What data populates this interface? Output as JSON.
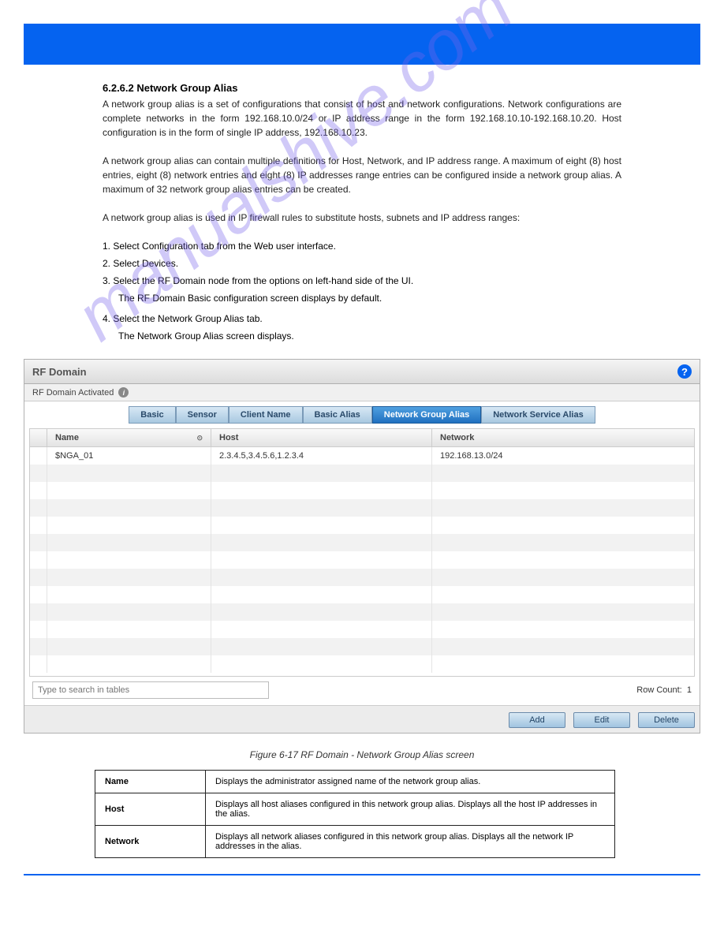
{
  "header": {
    "title": ""
  },
  "watermark": "manualshive.com",
  "heading_title": "6.2.6.2 Network Group Alias",
  "intro_p1": "A network group alias is a set of configurations that consist of host and network configurations. Network configurations are complete networks in the form 192.168.10.0/24 or IP address range in the form 192.168.10.10-192.168.10.20. Host configuration is in the form of single IP address, 192.168.10.23.",
  "intro_p2": "A network group alias can contain multiple definitions for Host, Network, and IP address range. A maximum of eight (8) host entries, eight (8) network entries and eight (8) IP addresses range entries can be configured inside a network group alias. A maximum of 32 network group alias entries can be created.",
  "intro_p3": "A network group alias is used in IP firewall rules to substitute hosts, subnets and IP address ranges:",
  "steps": {
    "s1": "1.  Select Configuration tab from the Web user interface.",
    "s2": "2. Select Devices.",
    "s3": "3. Select the RF Domain node from the options on left-hand side of the UI.",
    "s3_sub": "The RF Domain  Basic configuration screen displays by default.",
    "s4": "4. Select the Network Group Alias tab.",
    "s4_sub": "The Network Group Alias screen displays."
  },
  "panel": {
    "title": "RF Domain",
    "subtitle": "RF Domain Activated",
    "tabs": [
      "Basic",
      "Sensor",
      "Client Name",
      "Basic Alias",
      "Network Group Alias",
      "Network Service Alias"
    ],
    "active_tab_index": 4,
    "columns": {
      "name": "Name",
      "host": "Host",
      "network": "Network"
    },
    "rows": [
      {
        "name": "$NGA_01",
        "host": "2.3.4.5,3.4.5.6,1.2.3.4",
        "network": "192.168.13.0/24"
      }
    ],
    "search_placeholder": "Type to search in tables",
    "row_count_label": "Row Count:",
    "row_count_value": "1",
    "buttons": {
      "add": "Add",
      "edit": "Edit",
      "delete": "Delete"
    }
  },
  "fig_caption": "Figure 6-17 RF Domain - Network Group Alias screen",
  "desc_table": [
    {
      "label": "Name",
      "desc": "Displays the administrator assigned name of the network group alias."
    },
    {
      "label": "Host",
      "desc": "Displays all host aliases configured in this network group alias. Displays all the host IP addresses in the alias."
    },
    {
      "label": "Network",
      "desc": "Displays all network aliases configured in this network group alias. Displays all the network IP addresses in the alias."
    }
  ]
}
